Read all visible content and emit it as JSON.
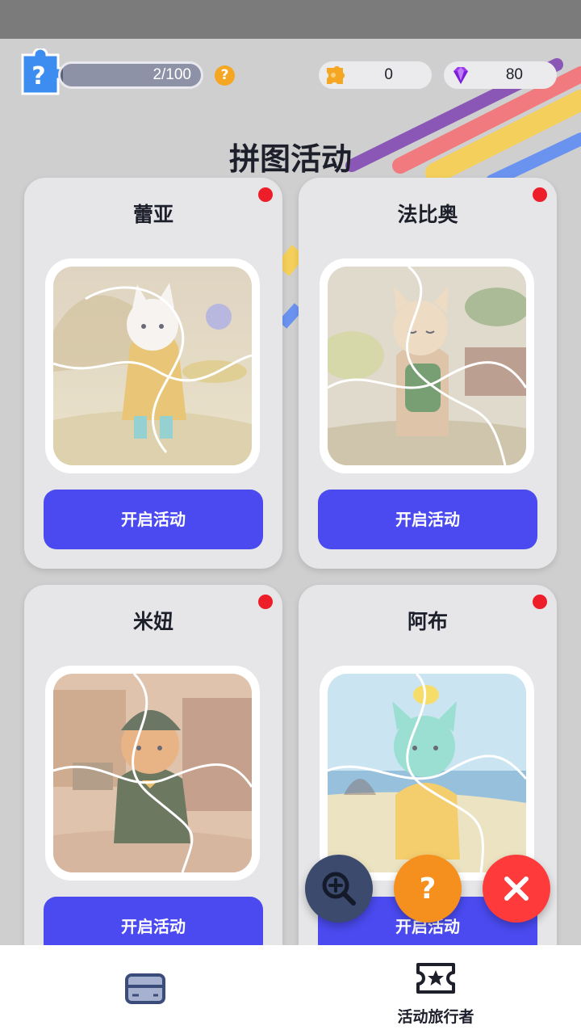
{
  "header": {
    "progress": {
      "current": 2,
      "total": 100,
      "text": "2/100"
    },
    "currencies": {
      "pieces": {
        "value": "0",
        "icon": "puzzle-piece-icon"
      },
      "gems": {
        "value": "80",
        "icon": "diamond-icon"
      }
    },
    "title": "拼图活动"
  },
  "cards": [
    {
      "name": "蕾亚",
      "button": "开启活动",
      "has_badge": true
    },
    {
      "name": "法比奥",
      "button": "开启活动",
      "has_badge": true
    },
    {
      "name": "米妞",
      "button": "开启活动",
      "has_badge": true
    },
    {
      "name": "阿布",
      "button": "开启活动",
      "has_badge": true
    }
  ],
  "fabs": {
    "zoom": "zoom-in-icon",
    "help": "help-icon",
    "close": "close-icon"
  },
  "bottom_nav": {
    "cards": {
      "label": "",
      "icon": "card-icon"
    },
    "travelers": {
      "label": "活动旅行者",
      "icon": "ticket-star-icon"
    }
  },
  "colors": {
    "accent": "#4a4af0",
    "badge": "#ee1d2a",
    "help": "#f5901e",
    "close": "#ff3a3a",
    "zoom": "#3c4a6e",
    "background": "#cfcfd0"
  }
}
